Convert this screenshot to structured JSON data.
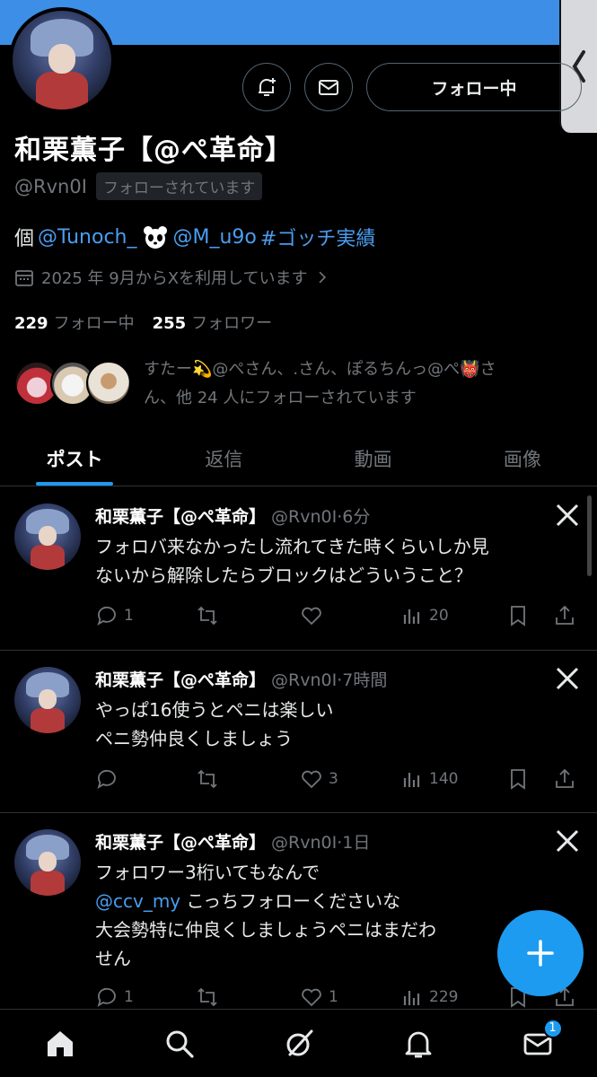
{
  "profile": {
    "name": "和栗薫子【@ぺ革命】",
    "handle": "@Rvn0I",
    "follows_you": "フォローされています",
    "follow_button": "フォロー中",
    "bio": {
      "prefix": "個",
      "mention1": "@Tunoch_",
      "mention2": "@M_u9o",
      "hashtag": "#ゴッチ実績"
    },
    "joined": "2025 年 9月からXを利用しています",
    "following_count": "229",
    "following_label": "フォロー中",
    "followers_count": "255",
    "followers_label": "フォロワー",
    "known_followers_line1": "すたー💫@ぺさん、.さん、ぽるちんっ@ぺ👹さ",
    "known_followers_line2": "ん、他 24 人にフォローされています"
  },
  "tabs": [
    "ポスト",
    "返信",
    "動画",
    "画像"
  ],
  "posts": [
    {
      "name": "和栗薫子【@ぺ革命】",
      "meta": "@Rvn0I·6分",
      "lines": [
        "フォロバ来なかったし流れてきた時くらいしか見",
        "ないから解除したらブロックはどういうこと？"
      ],
      "replies": "1",
      "reposts": "",
      "likes": "",
      "views": "20"
    },
    {
      "name": "和栗薫子【@ぺ革命】",
      "meta": "@Rvn0I·7時間",
      "lines": [
        "やっぱ16使うとペニは楽しい",
        "ペニ勢仲良くしましょう"
      ],
      "replies": "",
      "reposts": "",
      "likes": "3",
      "views": "140"
    },
    {
      "name": "和栗薫子【@ぺ革命】",
      "meta": "@Rvn0I·1日",
      "line1": "フォロワー3桁いてもなんで",
      "mention": "@ccv_my",
      "line2_rest": " こっちフォローくださいな",
      "line3": "大会勢特に仲良くしましょうペニはまだわ",
      "line4": "せん",
      "replies": "1",
      "reposts": "",
      "likes": "1",
      "views": "229"
    }
  ],
  "nav": {
    "messages_badge": "1"
  },
  "colors": {
    "accent": "#1d9bf0",
    "banner": "#3d8ee6",
    "muted": "#71767b",
    "link": "#4a9df0"
  }
}
